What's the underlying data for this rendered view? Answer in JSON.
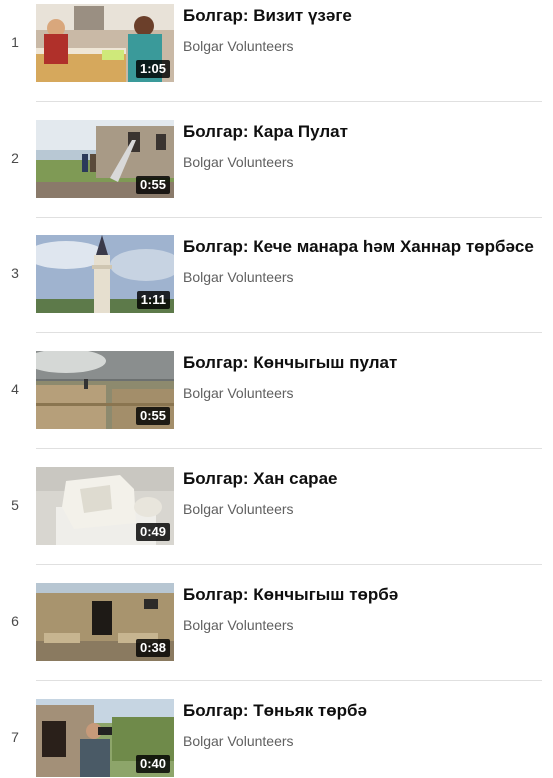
{
  "playlist": {
    "items": [
      {
        "index": "1",
        "title": "Болгар: Визит үзәге",
        "channel": "Bolgar Volunteers",
        "duration": "1:05",
        "thumbnail": "reception-desk-scene"
      },
      {
        "index": "2",
        "title": "Болгар: Кара Пулат",
        "channel": "Bolgar Volunteers",
        "duration": "0:55",
        "thumbnail": "stone-building-with-stairs"
      },
      {
        "index": "3",
        "title": "Болгар: Кече манара һәм Ханнар төрбәсе",
        "channel": "Bolgar Volunteers",
        "duration": "1:11",
        "thumbnail": "white-minaret-tower"
      },
      {
        "index": "4",
        "title": "Болгар: Көнчыгыш пулат",
        "channel": "Bolgar Volunteers",
        "duration": "0:55",
        "thumbnail": "ruined-stone-walls"
      },
      {
        "index": "5",
        "title": "Болгар: Хан сарае",
        "channel": "Bolgar Volunteers",
        "duration": "0:49",
        "thumbnail": "white-stone-ruins"
      },
      {
        "index": "6",
        "title": "Болгар: Көнчыгыш төрбә",
        "channel": "Bolgar Volunteers",
        "duration": "0:38",
        "thumbnail": "stone-mausoleum-doorway"
      },
      {
        "index": "7",
        "title": "Болгар: Төньяк төрбә",
        "channel": "Bolgar Volunteers",
        "duration": "0:40",
        "thumbnail": "person-filming-mausoleum"
      }
    ]
  }
}
